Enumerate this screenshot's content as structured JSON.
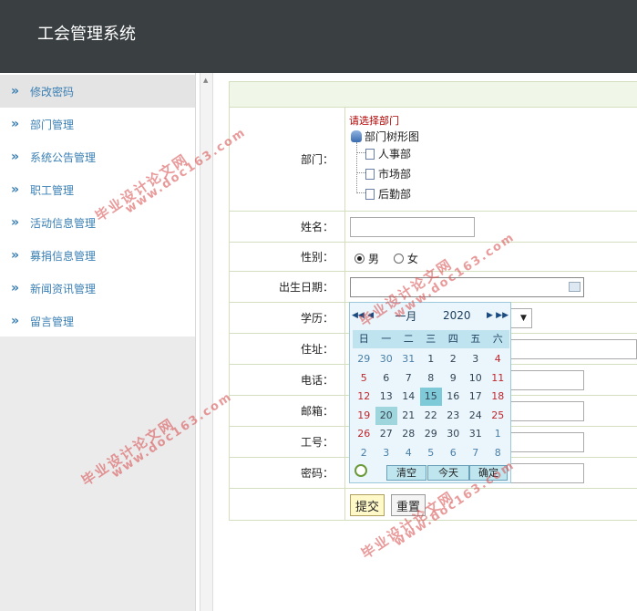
{
  "app": {
    "title": "工会管理系统"
  },
  "sidebar": {
    "items": [
      {
        "label": "修改密码",
        "arrow": "»"
      },
      {
        "label": "部门管理",
        "arrow": "»"
      },
      {
        "label": "系统公告管理",
        "arrow": "»"
      },
      {
        "label": "职工管理",
        "arrow": "»"
      },
      {
        "label": "活动信息管理",
        "arrow": "»"
      },
      {
        "label": "募捐信息管理",
        "arrow": "»"
      },
      {
        "label": "新闻资讯管理",
        "arrow": "»"
      },
      {
        "label": "留言管理",
        "arrow": "»"
      }
    ]
  },
  "form": {
    "department": {
      "label": "部门：",
      "hint": "请选择部门",
      "root": "部门树形图",
      "children": [
        "人事部",
        "市场部",
        "后勤部"
      ]
    },
    "name": {
      "label": "姓名：",
      "value": ""
    },
    "gender": {
      "label": "性别：",
      "options": [
        "男",
        "女"
      ],
      "selected": "男"
    },
    "birth": {
      "label": "出生日期：",
      "value": ""
    },
    "education": {
      "label": "学历："
    },
    "address": {
      "label": "住址："
    },
    "phone": {
      "label": "电话："
    },
    "email": {
      "label": "邮箱："
    },
    "employee_no": {
      "label": "工号："
    },
    "password": {
      "label": "密码："
    },
    "submit_label": "提交",
    "reset_label": "重置"
  },
  "calendar": {
    "month": "一月",
    "year": "2020",
    "weekdays": [
      "日",
      "一",
      "二",
      "三",
      "四",
      "五",
      "六"
    ],
    "days": [
      [
        "29",
        "30",
        "31",
        "1",
        "2",
        "3",
        "4"
      ],
      [
        "5",
        "6",
        "7",
        "8",
        "9",
        "10",
        "11"
      ],
      [
        "12",
        "13",
        "14",
        "15",
        "16",
        "17",
        "18"
      ],
      [
        "19",
        "20",
        "21",
        "22",
        "23",
        "24",
        "25"
      ],
      [
        "26",
        "27",
        "28",
        "29",
        "30",
        "31",
        "1"
      ],
      [
        "2",
        "3",
        "4",
        "5",
        "6",
        "7",
        "8"
      ]
    ],
    "clear_label": "清空",
    "today_label": "今天",
    "ok_label": "确定"
  },
  "watermark": {
    "text1": "毕业设计论文网",
    "text2": "www.doc163.com"
  },
  "colors": {
    "topbar": "#3a3f42",
    "link": "#3a7fb4",
    "hint": "#b40000",
    "weekend": "#c0262c"
  }
}
